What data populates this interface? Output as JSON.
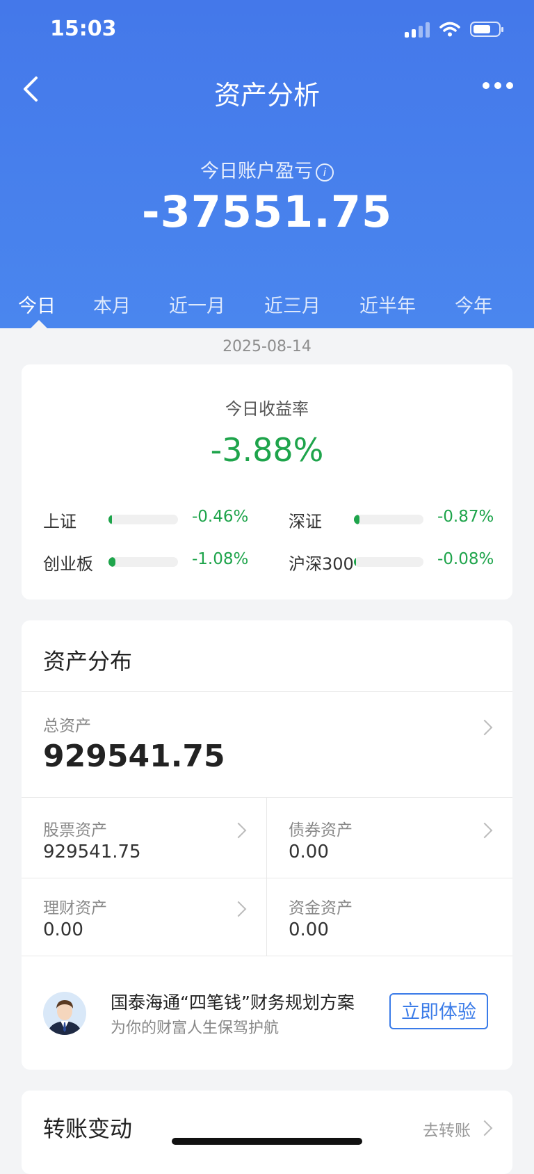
{
  "status": {
    "time": "15:03"
  },
  "nav": {
    "title": "资产分析"
  },
  "summary": {
    "label": "今日账户盈亏",
    "value": "-37551.75"
  },
  "tabs": [
    {
      "label": "今日",
      "active": true
    },
    {
      "label": "本月"
    },
    {
      "label": "近一月"
    },
    {
      "label": "近三月"
    },
    {
      "label": "近半年"
    },
    {
      "label": "今年"
    }
  ],
  "date": "2025-08-14",
  "returns": {
    "label": "今日收益率",
    "value": "-3.88%",
    "indices": [
      {
        "name": "上证",
        "value": "-0.46%",
        "fill": 0.05
      },
      {
        "name": "深证",
        "value": "-0.87%",
        "fill": 0.08
      },
      {
        "name": "创业板",
        "value": "-1.08%",
        "fill": 0.1
      },
      {
        "name": "沪深300",
        "value": "-0.08%",
        "fill": 0.01
      }
    ]
  },
  "assets": {
    "title": "资产分布",
    "total_label": "总资产",
    "total_value": "929541.75",
    "items": [
      {
        "label": "股票资产",
        "value": "929541.75"
      },
      {
        "label": "债券资产",
        "value": "0.00"
      },
      {
        "label": "理财资产",
        "value": "0.00"
      },
      {
        "label": "资金资产",
        "value": "0.00"
      }
    ]
  },
  "promo": {
    "title": "国泰海通“四笔钱”财务规划方案",
    "subtitle": "为你的财富人生保驾护航",
    "button": "立即体验"
  },
  "transfer": {
    "title": "转账变动",
    "link": "去转账"
  },
  "colors": {
    "header": "#4478ea",
    "negative": "#1ea44b",
    "accent": "#3a7be8"
  }
}
